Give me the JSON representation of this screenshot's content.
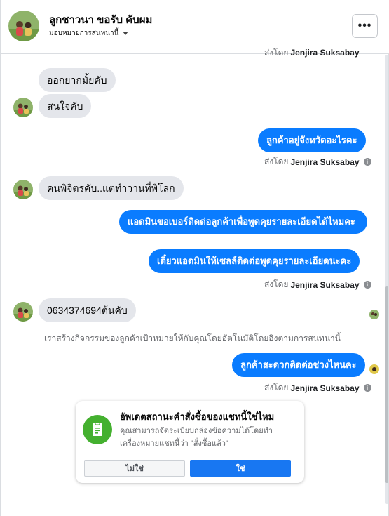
{
  "header": {
    "name": "ลูกชาวนา ขอรับ คับผม",
    "subtitle": "มอบหมายการสนทนานี้",
    "more_label": "•••"
  },
  "messages": {
    "cutoff_sent_by_prefix": "ส่งโดย",
    "cutoff_sent_by_name": "Jenjira Suksabay",
    "in_1": "ออกยากมั้ยคับ",
    "in_2": "สนใจคับ",
    "out_1": "ลูกค้าอยู่จังหวัดอะไรคะ",
    "sent_by_1_prefix": "ส่งโดย",
    "sent_by_1_name": "Jenjira Suksabay",
    "in_3": "คนพิจิตรคับ..แต่ทำวานที่พิโลก",
    "out_2": "แอดมินขอเบอร์ติดต่อลูกค้าเพื่อพูดคุยรายละเอียดได้ไหมคะ",
    "out_3": "เดี๋ยวแอดมินให้เซลล์ติดต่อพูดคุยรายละเอียดนะคะ",
    "sent_by_2_prefix": "ส่งโดย",
    "sent_by_2_name": "Jenjira Suksabay",
    "in_4": "0634374694ต้นคับ",
    "notice": "เราสร้างกิจกรรมของลูกค้าเป้าหมายให้กับคุณโดยอัตโนมัติโดยอิงตามการสนทนานี้",
    "out_4": "ลูกค้าสะดวกติดต่อช่วงไหนคะ",
    "sent_by_3_prefix": "ส่งโดย",
    "sent_by_3_name": "Jenjira Suksabay"
  },
  "order_card": {
    "title": "อัพเดตสถานะคำสั่งซื้อของแชทนี้ใช่ไหม",
    "body": "คุณสามารถจัดระเบียบกล่องข้อความได้โดยทำเครื่องหมายแชทนี้ว่า \"สั่งซื้อแล้ว\"",
    "no_label": "ไม่ใช่",
    "yes_label": "ใช่",
    "accent": "#44b02f"
  },
  "colors": {
    "outgoing_bubble": "#0a7cff",
    "incoming_bubble": "#e4e6eb",
    "primary_button": "#1877f2"
  },
  "icons": {
    "more": "ellipsis-icon",
    "info": "info-icon",
    "card": "clipboard-icon"
  }
}
